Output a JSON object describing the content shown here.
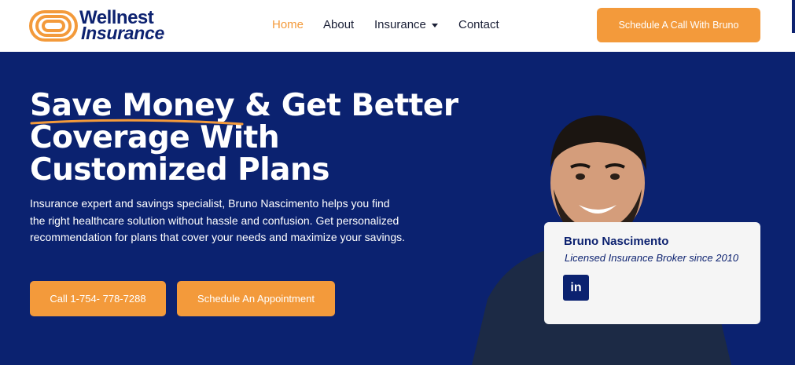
{
  "brand": {
    "name_line1": "Wellnest",
    "name_line2": "Insurance",
    "primary_color": "#0b2270",
    "accent_color": "#f39a3b"
  },
  "nav": {
    "items": [
      {
        "label": "Home",
        "active": true
      },
      {
        "label": "About",
        "active": false
      },
      {
        "label": "Insurance",
        "active": false,
        "has_dropdown": true
      },
      {
        "label": "Contact",
        "active": false
      }
    ],
    "cta_label": "Schedule A Call With Bruno"
  },
  "hero": {
    "headline": "Save Money & Get Better Coverage With Customized Plans",
    "description": "Insurance expert and savings specialist, Bruno Nascimento helps you find the right healthcare solution without hassle and confusion. Get personalized recommendation for plans that cover your needs and maximize your savings.",
    "call_button": "Call 1-754- 778-7288",
    "appointment_button": "Schedule An Appointment"
  },
  "agent_card": {
    "name": "Bruno Nascimento",
    "role": "Licensed Insurance Broker since 2010",
    "social_icon": "linkedin-icon",
    "social_label": "in"
  }
}
